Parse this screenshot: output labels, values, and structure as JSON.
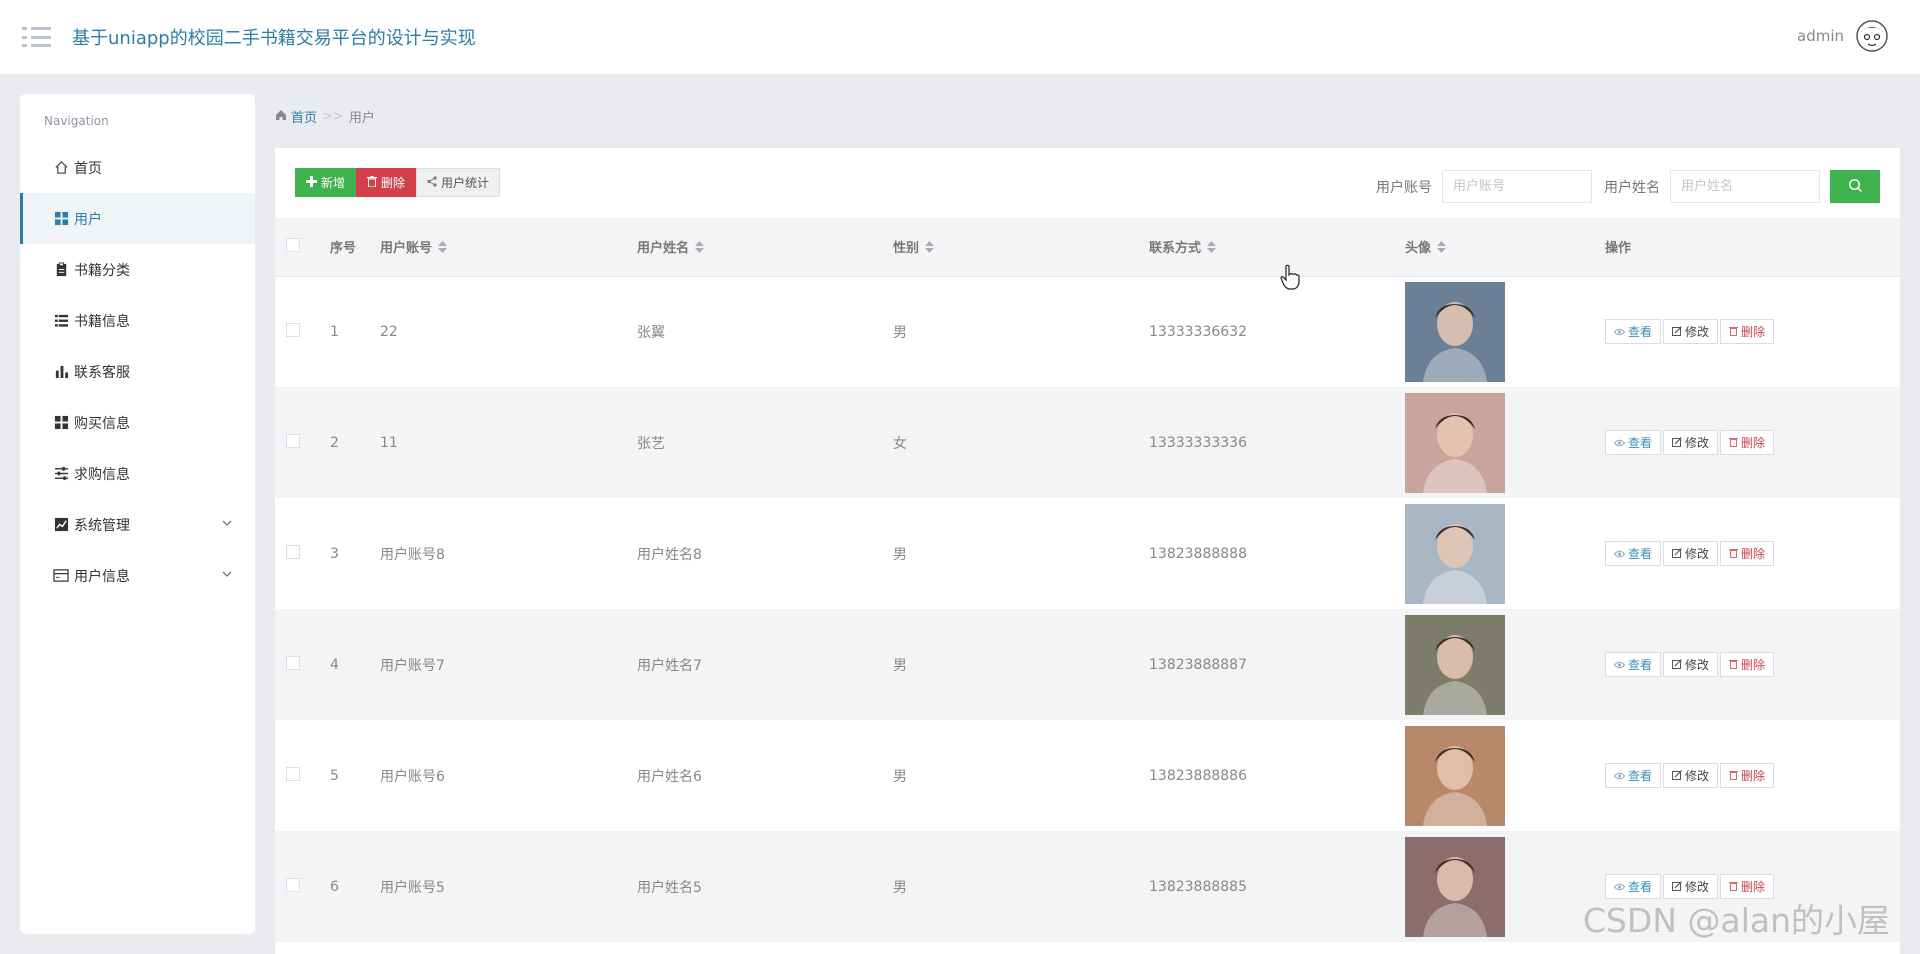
{
  "header": {
    "title": "基于uniapp的校园二手书籍交易平台的设计与实现",
    "username": "admin"
  },
  "sidebar": {
    "heading": "Navigation",
    "items": [
      {
        "label": "首页",
        "icon": "home-icon"
      },
      {
        "label": "用户",
        "icon": "grid-icon",
        "active": true
      },
      {
        "label": "书籍分类",
        "icon": "clipboard-icon"
      },
      {
        "label": "书籍信息",
        "icon": "list-icon"
      },
      {
        "label": "联系客服",
        "icon": "bar-chart-icon"
      },
      {
        "label": "购买信息",
        "icon": "grid-icon"
      },
      {
        "label": "求购信息",
        "icon": "sliders-icon"
      },
      {
        "label": "系统管理",
        "icon": "line-chart-icon",
        "expandable": true
      },
      {
        "label": "用户信息",
        "icon": "card-icon",
        "expandable": true
      }
    ]
  },
  "breadcrumb": {
    "home": "首页",
    "separator": ">>",
    "current": "用户"
  },
  "toolbar": {
    "add_label": "新增",
    "delete_label": "删除",
    "stats_label": "用户统计"
  },
  "search": {
    "account_label": "用户账号",
    "account_placeholder": "用户账号",
    "name_label": "用户姓名",
    "name_placeholder": "用户姓名"
  },
  "table": {
    "columns": [
      "序号",
      "用户账号",
      "用户姓名",
      "性别",
      "联系方式",
      "头像",
      "操作"
    ],
    "actions": {
      "view": "查看",
      "edit": "修改",
      "delete": "删除"
    },
    "rows": [
      {
        "index": "1",
        "account": "22",
        "name": "张翼",
        "gender": "男",
        "phone": "13333336632",
        "avatar_color": "#6b7f96"
      },
      {
        "index": "2",
        "account": "11",
        "name": "张艺",
        "gender": "女",
        "phone": "13333333336",
        "avatar_color": "#c9a49a"
      },
      {
        "index": "3",
        "account": "用户账号8",
        "name": "用户姓名8",
        "gender": "男",
        "phone": "13823888888",
        "avatar_color": "#a9b6c4"
      },
      {
        "index": "4",
        "account": "用户账号7",
        "name": "用户姓名7",
        "gender": "男",
        "phone": "13823888887",
        "avatar_color": "#7d7b6a"
      },
      {
        "index": "5",
        "account": "用户账号6",
        "name": "用户姓名6",
        "gender": "男",
        "phone": "13823888886",
        "avatar_color": "#b9886a"
      },
      {
        "index": "6",
        "account": "用户账号5",
        "name": "用户姓名5",
        "gender": "男",
        "phone": "13823888885",
        "avatar_color": "#8b6e6c"
      }
    ]
  },
  "watermark": "CSDN @alan的小屋",
  "colors": {
    "accent": "#2b7ea8",
    "green": "#3fb24e",
    "red": "#d1404b"
  }
}
